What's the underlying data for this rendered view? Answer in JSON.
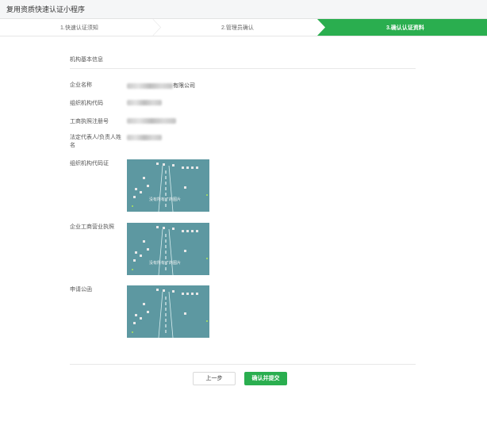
{
  "window": {
    "title": "复用资质快速认证小程序"
  },
  "steps": [
    {
      "label": "1.快速认证须知",
      "state": "done"
    },
    {
      "label": "2.管理员确认",
      "state": "done"
    },
    {
      "label": "3.确认认证资料",
      "state": "active"
    }
  ],
  "colors": {
    "accent": "#2aae4f",
    "image_bg": "#5d98a1"
  },
  "section": {
    "title": "机构基本信息"
  },
  "fields": {
    "company_name": {
      "label": "企业名称",
      "value_suffix": "有限公司"
    },
    "org_code": {
      "label": "组织机构代码"
    },
    "reg_no": {
      "label": "工商执照注册号"
    },
    "legal_rep": {
      "label": "法定代表人/负责人姓名"
    }
  },
  "documents": {
    "org_code_cert": {
      "label": "组织机构代码证",
      "caption": "没有所有了的图片"
    },
    "business_license": {
      "label": "企业工商营业执照",
      "caption": "没有所有了的图片"
    },
    "application_letter": {
      "label": "申请公函"
    }
  },
  "buttons": {
    "prev": "上一步",
    "submit": "确认并提交"
  }
}
